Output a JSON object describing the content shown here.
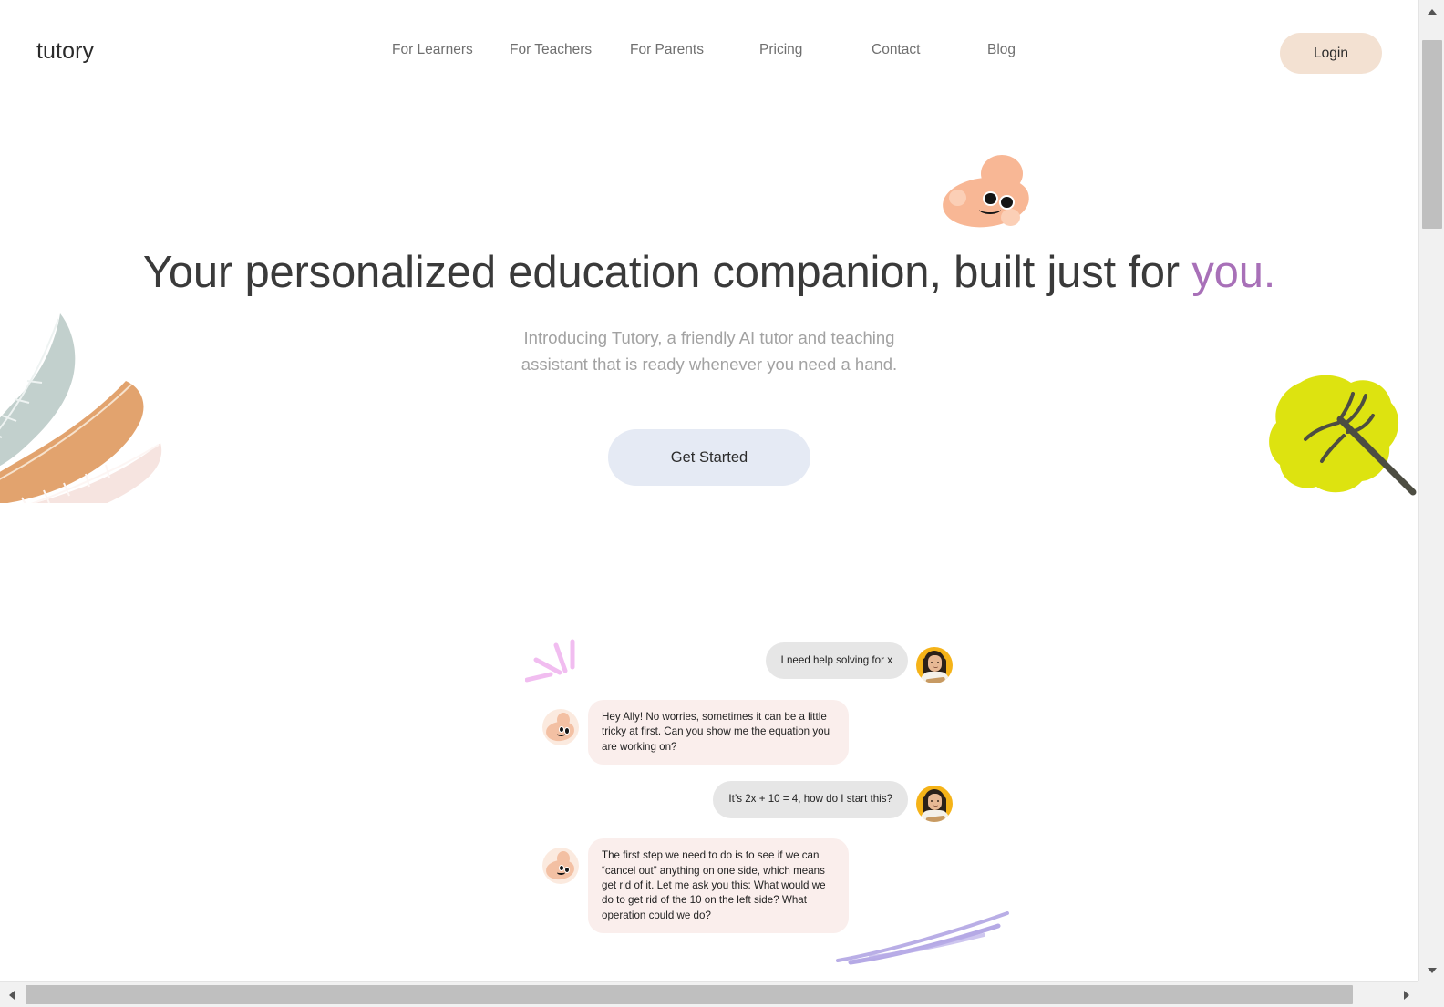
{
  "brand": {
    "logo_text": "tutory",
    "accent_purple": "#a870b8",
    "button_peach": "#f3e1d2",
    "button_blue": "#e5eaf4",
    "mascot_peach": "#f8b795",
    "tree_yellow": "#dde310",
    "leaf_sage": "#c2d0cd",
    "leaf_orange": "#e2a36e",
    "leaf_pink": "#f6e4e0",
    "sparkle_pink": "#eda8ec",
    "swoosh_purple": "#a89ae0",
    "avatar_yellow": "#f5b318"
  },
  "nav": {
    "items": [
      {
        "label": "For Learners"
      },
      {
        "label": "For Teachers"
      },
      {
        "label": "For Parents"
      },
      {
        "label": "Pricing"
      },
      {
        "label": "Contact"
      },
      {
        "label": "Blog"
      }
    ],
    "login_label": "Login"
  },
  "hero": {
    "title_main": "Your personalized education companion, built just for ",
    "title_accent": "you.",
    "subtitle": "Introducing Tutory, a friendly AI tutor and teaching assistant that is ready whenever you need a hand.",
    "cta_label": "Get Started"
  },
  "chat": {
    "messages": [
      {
        "sender": "user",
        "text": "I need help solving for x"
      },
      {
        "sender": "bot",
        "text": "Hey Ally! No worries, sometimes it can be a little tricky at first. Can you show me the equation you are working on?"
      },
      {
        "sender": "user",
        "text": "It’s 2x + 10 = 4, how do I start this?"
      },
      {
        "sender": "bot",
        "text": "The first step we need to do is to see if we can “cancel out” anything on one side, which means get rid of it. Let me ask you this: What would we do to get rid of the 10 on the left side? What operation could we do?"
      }
    ]
  },
  "icons": {
    "scroll_up": "scroll-up-arrow-icon",
    "scroll_down": "scroll-down-arrow-icon",
    "scroll_left": "scroll-left-arrow-icon",
    "scroll_right": "scroll-right-arrow-icon"
  }
}
